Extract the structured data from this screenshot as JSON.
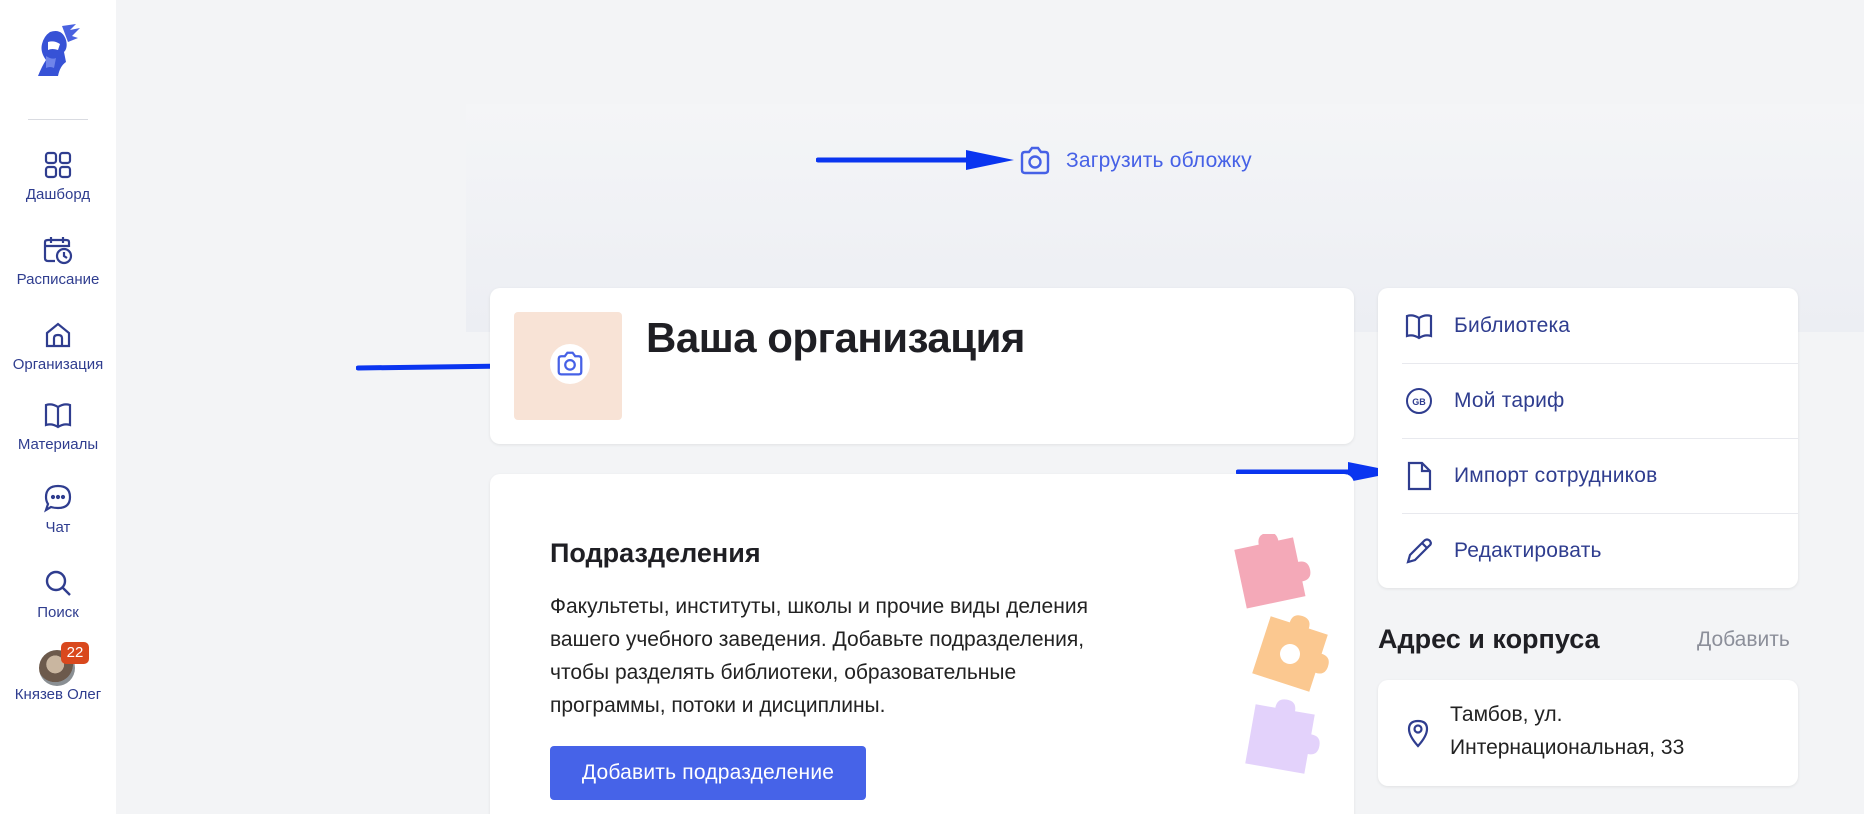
{
  "sidebar": {
    "logo_icon": "knight-helmet-logo",
    "items": [
      {
        "label": "Дашборд",
        "icon": "grid-icon"
      },
      {
        "label": "Расписание",
        "icon": "calendar-clock-icon"
      },
      {
        "label": "Организация",
        "icon": "home-icon"
      },
      {
        "label": "Материалы",
        "icon": "book-icon"
      },
      {
        "label": "Чат",
        "icon": "chat-icon"
      },
      {
        "label": "Поиск",
        "icon": "search-icon"
      }
    ],
    "user": {
      "name": "Князев Олег",
      "badge": "22"
    }
  },
  "cover": {
    "upload_label": "Загрузить обложку"
  },
  "org": {
    "title": "Ваша организация"
  },
  "departments": {
    "title": "Подразделения",
    "description": "Факультеты, институты, школы и прочие виды деления вашего учебного заведения. Добавьте подразделения, чтобы разделять библиотеки, образовательные программы, потоки и дисциплины.",
    "button": "Добавить подразделение"
  },
  "menu": {
    "items": [
      {
        "label": "Библиотека",
        "icon": "book-icon"
      },
      {
        "label": "Мой тариф",
        "icon": "gb-circle-icon"
      },
      {
        "label": "Импорт сотрудников",
        "icon": "file-icon"
      },
      {
        "label": "Редактировать",
        "icon": "pencil-icon"
      }
    ]
  },
  "address": {
    "title": "Адрес и корпуса",
    "add_label": "Добавить",
    "text": "Тамбов, ул. Интернациональная, 33"
  },
  "colors": {
    "accent": "#4661e6",
    "nav_text": "#2f3d8f",
    "badge": "#d9481d",
    "arrow": "#0a35f0"
  }
}
